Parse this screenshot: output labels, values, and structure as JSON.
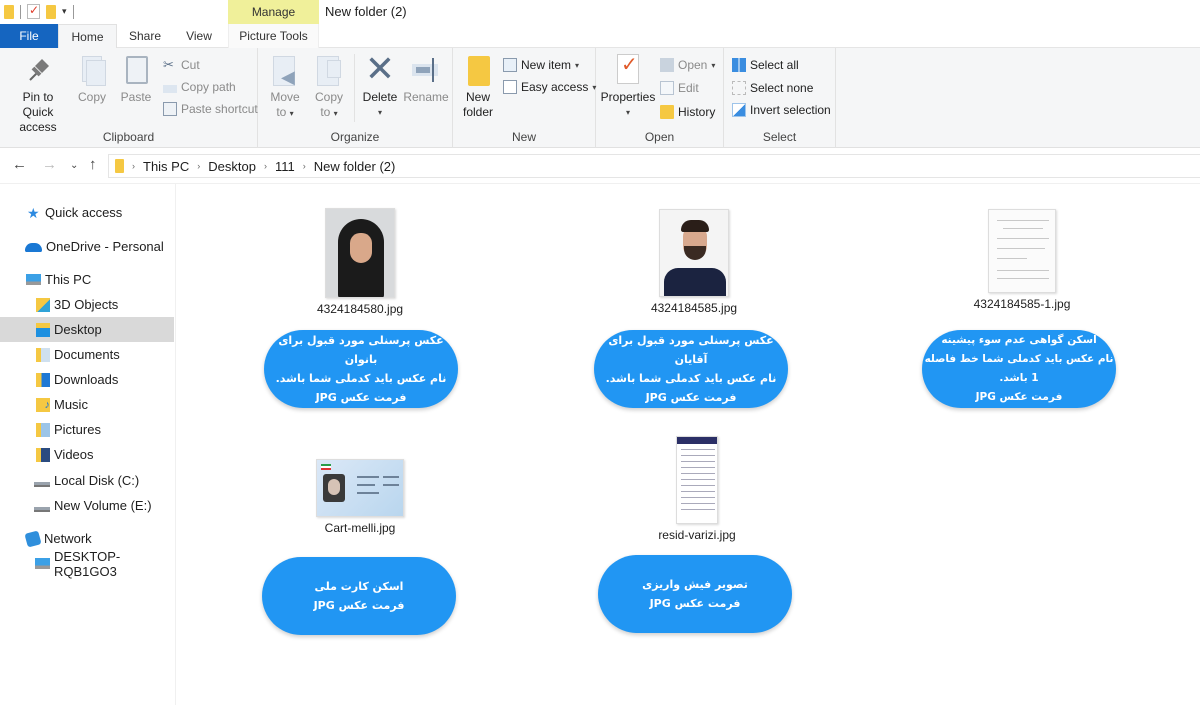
{
  "window": {
    "title": "New folder (2)",
    "contextual_tab_group": "Manage"
  },
  "tabs": [
    {
      "label": "File"
    },
    {
      "label": "Home"
    },
    {
      "label": "Share"
    },
    {
      "label": "View"
    },
    {
      "label": "Picture Tools"
    }
  ],
  "ribbon": {
    "clipboard": {
      "label": "Clipboard",
      "pin_line1": "Pin to Quick",
      "pin_line2": "access",
      "copy": "Copy",
      "paste": "Paste",
      "cut": "Cut",
      "copy_path": "Copy path",
      "paste_shortcut": "Paste shortcut"
    },
    "organize": {
      "label": "Organize",
      "move_line1": "Move",
      "move_line2": "to",
      "copy_line1": "Copy",
      "copy_line2": "to",
      "delete": "Delete",
      "rename": "Rename"
    },
    "new": {
      "label": "New",
      "folder_line1": "New",
      "folder_line2": "folder",
      "new_item": "New item",
      "easy_access": "Easy access"
    },
    "open": {
      "label": "Open",
      "properties": "Properties",
      "open": "Open",
      "edit": "Edit",
      "history": "History"
    },
    "select": {
      "label": "Select",
      "select_all": "Select all",
      "select_none": "Select none",
      "invert": "Invert selection"
    }
  },
  "address": {
    "crumbs": [
      "This PC",
      "Desktop",
      "111",
      "New folder (2)"
    ]
  },
  "sidebar": {
    "items": [
      {
        "label": "Quick access",
        "icon": "star-icon"
      },
      {
        "label": "OneDrive - Personal",
        "icon": "cloud-icon"
      },
      {
        "label": "This PC",
        "icon": "computer-icon"
      },
      {
        "label": "3D Objects",
        "icon": "3d-objects-folder-icon"
      },
      {
        "label": "Desktop",
        "icon": "desktop-folder-icon",
        "selected": true
      },
      {
        "label": "Documents",
        "icon": "documents-folder-icon"
      },
      {
        "label": "Downloads",
        "icon": "downloads-folder-icon"
      },
      {
        "label": "Music",
        "icon": "music-folder-icon"
      },
      {
        "label": "Pictures",
        "icon": "pictures-folder-icon"
      },
      {
        "label": "Videos",
        "icon": "videos-folder-icon"
      },
      {
        "label": "Local Disk (C:)",
        "icon": "drive-icon"
      },
      {
        "label": "New Volume (E:)",
        "icon": "drive-icon"
      },
      {
        "label": "Network",
        "icon": "network-icon"
      },
      {
        "label": "DESKTOP-RQB1GO3",
        "icon": "computer-icon"
      }
    ]
  },
  "files": [
    {
      "name": "4324184580.jpg",
      "thumb": "woman-portrait",
      "note": [
        "عکس پرسنلی مورد قبول برای بانوان",
        "نام عکس باید کدملی شما باشد.",
        "فرمت عکس JPG"
      ]
    },
    {
      "name": "4324184585.jpg",
      "thumb": "man-portrait",
      "note": [
        "عکس پرسنلی مورد قبول برای آقایان",
        "نام عکس باید کدملی شما باشد.",
        "فرمت عکس JPG"
      ]
    },
    {
      "name": "4324184585-1.jpg",
      "thumb": "certificate-scan",
      "note": [
        "اسکن گواهی عدم سوء پیشینه",
        "نام عکس باید کدملی شما خط فاصله 1 باشد.",
        "فرمت عکس JPG"
      ]
    },
    {
      "name": "Cart-melli.jpg",
      "thumb": "national-id-card",
      "note": [
        "اسکن کارت ملی",
        "فرمت عکس JPG"
      ]
    },
    {
      "name": "resid-varizi.jpg",
      "thumb": "payment-receipt-screenshot",
      "note": [
        "تصویر فیش واریزی",
        "فرمت عکس JPG"
      ]
    }
  ],
  "colors": {
    "file_tab": "#1565c0",
    "manage_tab": "#f0f09a",
    "note_bubble": "#2196f3",
    "selected_nav": "#d9d9d9"
  }
}
